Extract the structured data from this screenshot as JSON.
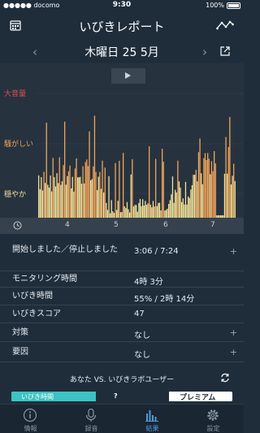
{
  "status_bar": {
    "carrier": "●●●●● docomo",
    "time": "9:30",
    "battery": "100%"
  },
  "nav": {
    "title": "いびきレポート",
    "left_icon": "calendar-icon",
    "right_icon": "trend-icon"
  },
  "date_bar": {
    "date": "木曜日 25 5月",
    "prev": "‹",
    "next": "›"
  },
  "chart": {
    "levels": [
      {
        "label": "大音量",
        "color": "#e0504a"
      },
      {
        "label": "騒がしい",
        "color": "#f0a35a"
      },
      {
        "label": "穏やか",
        "color": "#f3e29a"
      }
    ],
    "axis_ticks": [
      "4",
      "5",
      "6",
      "7"
    ]
  },
  "chart_data": {
    "type": "area",
    "y_categories": [
      "穏やか",
      "騒がしい",
      "大音量"
    ],
    "x_ticks": [
      "4",
      "5",
      "6",
      "7"
    ],
    "colors": {
      "quiet": "#f3e29a",
      "loud": "#f0a35a",
      "background": "#26333f"
    }
  },
  "details": [
    {
      "label": "開始しました／停止しました",
      "value": "3:06 / 7:24",
      "expandable": true
    },
    {
      "label": "モニタリング時間",
      "value": "4時 3分",
      "expandable": false
    },
    {
      "label": "いびき時間",
      "value": "55% / 2時 14分",
      "expandable": false
    },
    {
      "label": "いびきスコア",
      "value": "47",
      "expandable": false
    },
    {
      "label": "対策",
      "value": "なし",
      "expandable": true
    },
    {
      "label": "要因",
      "value": "なし",
      "expandable": true
    }
  ],
  "plus_sign": "+",
  "compare": {
    "title": "あなた VS. いびきラボユーザー",
    "fill_label": "いびき時間",
    "unknown": "?",
    "premium": "プレミアム"
  },
  "tabs": [
    {
      "label": "情報",
      "icon": "info-icon",
      "active": false
    },
    {
      "label": "録音",
      "icon": "microphone-icon",
      "active": false
    },
    {
      "label": "結果",
      "icon": "bar-chart-icon",
      "active": true
    },
    {
      "label": "設定",
      "icon": "gear-icon",
      "active": false
    }
  ]
}
